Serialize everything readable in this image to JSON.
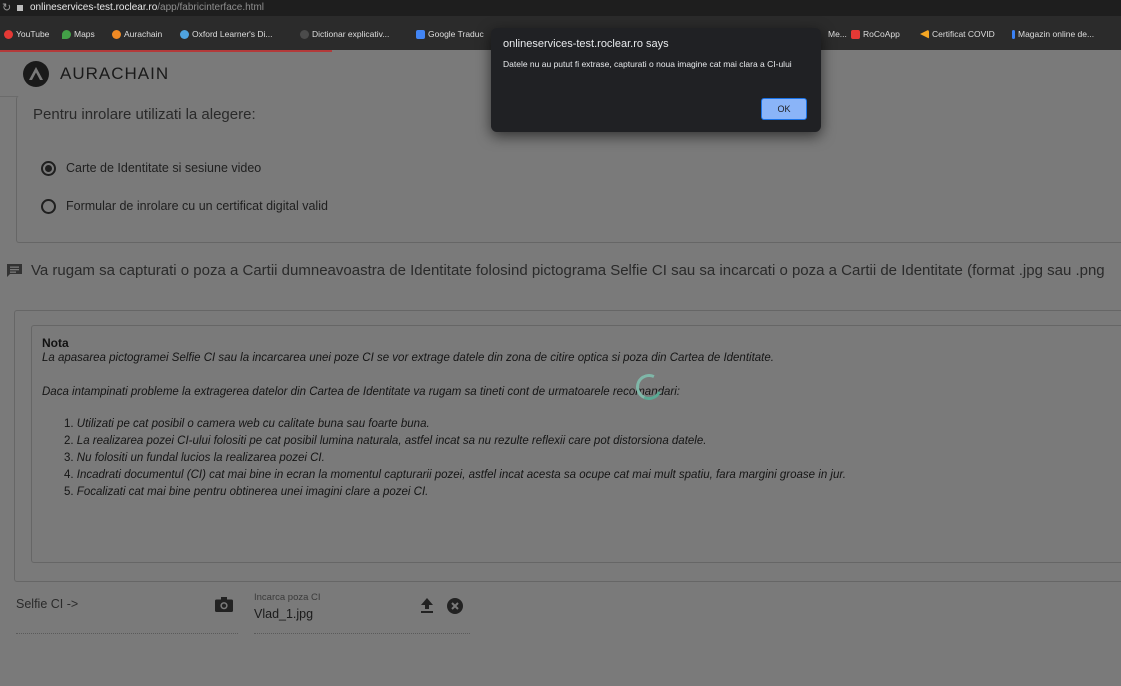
{
  "browser": {
    "url_domain": "onlineservices-test.roclear.ro",
    "url_path": "/app/fabricinterface.html",
    "bookmarks": [
      {
        "label": "YouTube",
        "icon": "youtube-icon",
        "color": "#e53935"
      },
      {
        "label": "Maps",
        "icon": "maps-icon",
        "color": "#43a047"
      },
      {
        "label": "Aurachain",
        "icon": "aurachain-icon",
        "color": "#f08a24"
      },
      {
        "label": "Oxford Learner's Di...",
        "icon": "oxford-icon",
        "color": "#4fa3e0"
      },
      {
        "label": "Dictionar explicativ...",
        "icon": "dex-icon",
        "color": "#4b4b4b"
      },
      {
        "label": "Google Traduc",
        "icon": "translate-icon",
        "color": "#4285f4"
      },
      {
        "label": "Me...",
        "icon": "bookmark-icon",
        "color": "#888888"
      },
      {
        "label": "RoCoApp",
        "icon": "rocoapp-icon",
        "color": "#e53935"
      },
      {
        "label": "Certificat COVID",
        "icon": "covid-icon",
        "color": "#f5a623"
      },
      {
        "label": "Magazin online de...",
        "icon": "shop-icon",
        "color": "#3b82f6"
      }
    ]
  },
  "dialog": {
    "title": "onlineservices-test.roclear.ro says",
    "message": "Datele nu au putut fi extrase, capturati o noua imagine cat mai clara a CI-ului",
    "ok_label": "OK"
  },
  "brand": {
    "name": "AURACHAIN"
  },
  "enrollment": {
    "title": "Pentru inrolare utilizati la alegere:",
    "options": [
      {
        "label": "Carte de Identitate si sesiune video",
        "selected": true
      },
      {
        "label": "Formular de inrolare cu un certificat digital valid",
        "selected": false
      }
    ]
  },
  "instruction": "Va rugam sa capturati o poza a Cartii dumneavoastra de Identitate folosind pictograma Selfie CI sau sa incarcati o poza a Cartii de Identitate (format .jpg sau .png",
  "nota": {
    "title": "Nota",
    "paragraph1": "La apasarea pictogramei Selfie CI sau la incarcarea unei poze CI se vor extrage datele din zona de citire optica si  poza din Cartea de Identitate.",
    "paragraph2": "Daca intampinati probleme la extragerea datelor din Cartea de Identitate va rugam sa tineti cont de urmatoarele recomandari:",
    "items": [
      {
        "num": "1.",
        "text": "Utilizati pe cat posibil o camera web cu calitate buna sau foarte buna."
      },
      {
        "num": "2.",
        "text": "La realizarea pozei CI-ului folositi pe cat posibil lumina naturala, astfel incat sa nu rezulte reflexii care pot distorsiona datele."
      },
      {
        "num": "3.",
        "text": "Nu folositi un fundal lucios la realizarea pozei CI."
      },
      {
        "num": "4.",
        "text": "Incadrati documentul (CI) cat mai bine in ecran la momentul capturarii pozei, astfel incat acesta sa ocupe cat mai mult spatiu, fara margini groase in jur."
      },
      {
        "num": "5.",
        "text": "Focalizati cat mai bine pentru obtinerea unei imagini clare a pozei CI."
      }
    ]
  },
  "selfie": {
    "label": "Selfie CI ->"
  },
  "upload": {
    "label": "Incarca poza CI",
    "value": "Vlad_1.jpg"
  }
}
